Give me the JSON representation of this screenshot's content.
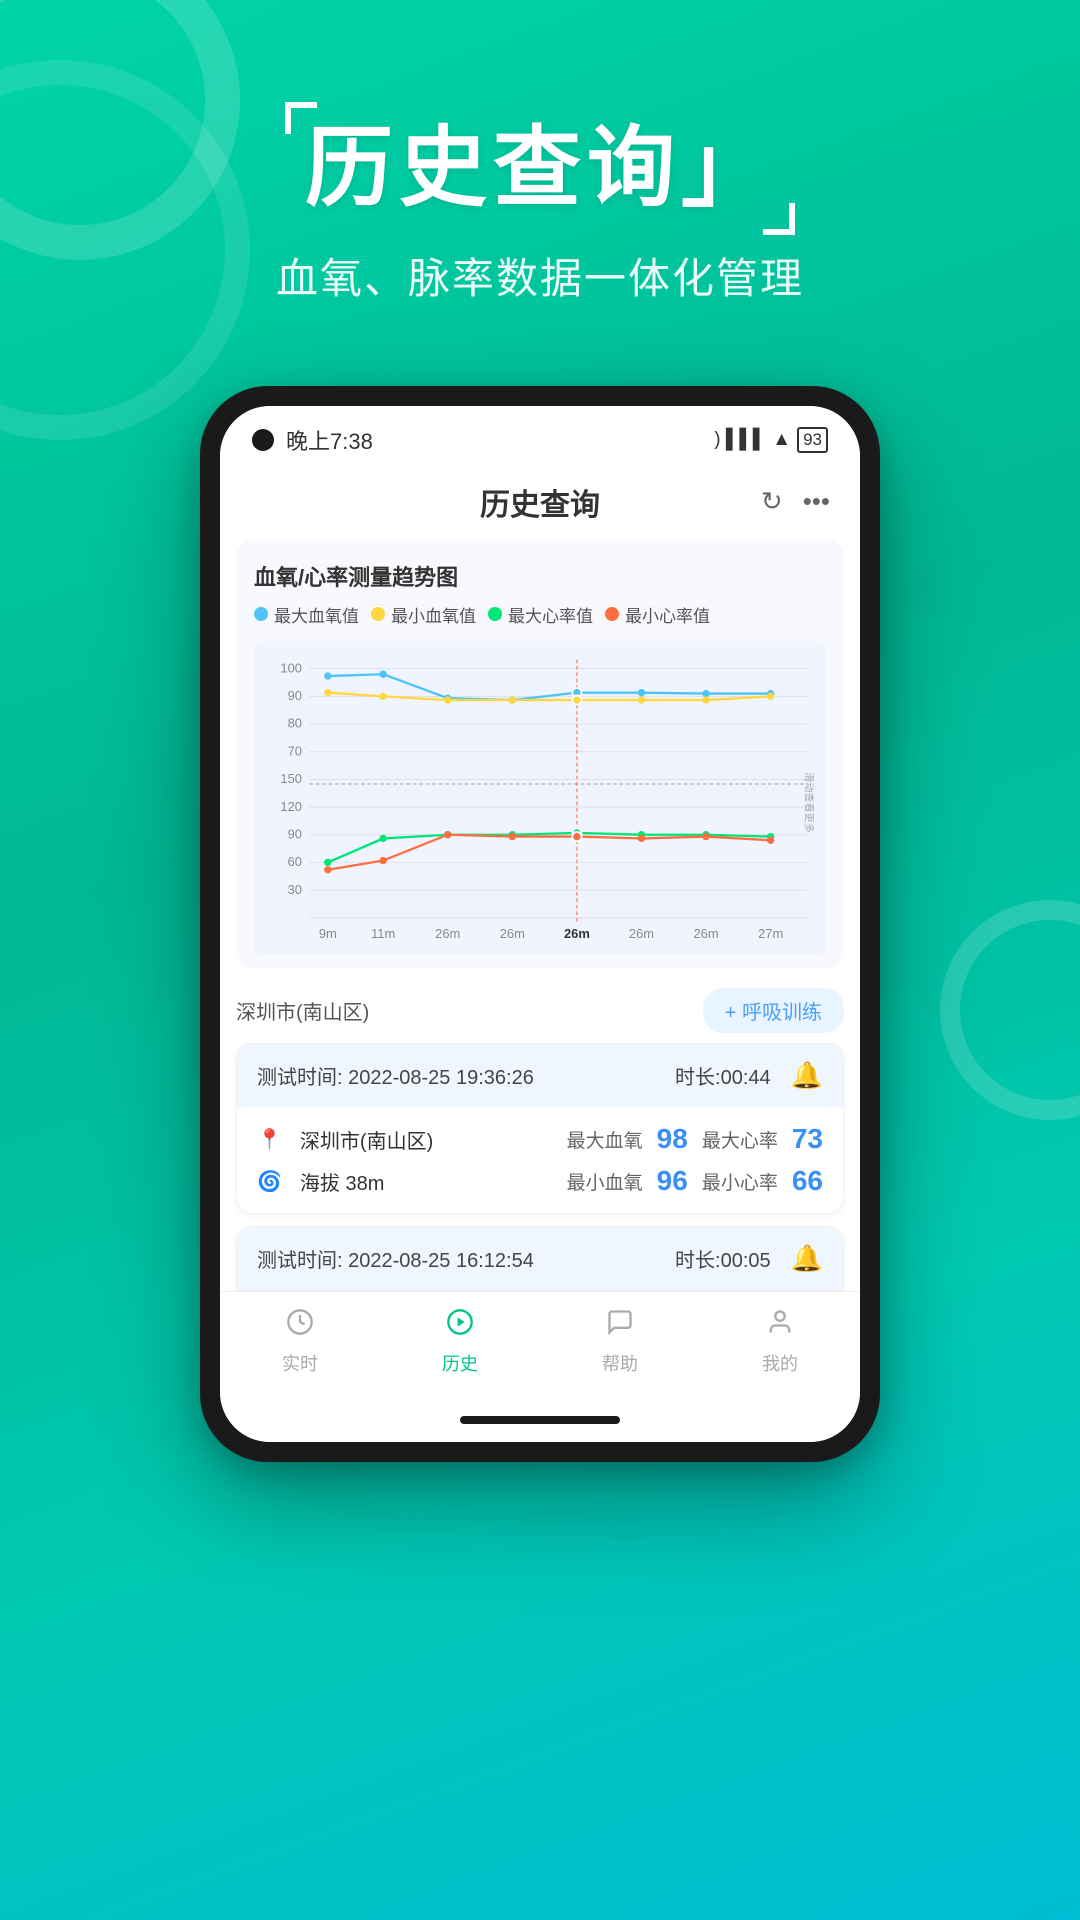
{
  "app": {
    "background_gradient_start": "#00d4a8",
    "background_gradient_end": "#00bcd4"
  },
  "header": {
    "title": "历史查询」",
    "title_prefix": "「历史查询",
    "subtitle": "血氧、脉率数据一体化管理"
  },
  "phone": {
    "status_bar": {
      "time": "晚上7:38",
      "battery": "93"
    },
    "app_title": "历史查询",
    "refresh_icon": "↻",
    "more_icon": "···"
  },
  "chart": {
    "title": "血氧/心率测量趋势图",
    "legend": [
      {
        "label": "最大血氧值",
        "color": "#4fc3f7"
      },
      {
        "label": "最小血氧值",
        "color": "#ffd740"
      },
      {
        "label": "最大心率值",
        "color": "#00e676"
      },
      {
        "label": "最小心率值",
        "color": "#ff6e40"
      }
    ],
    "y_labels_top": [
      "100",
      "90",
      "80",
      "70",
      "150"
    ],
    "y_labels_bottom": [
      "120",
      "90",
      "60",
      "30"
    ],
    "x_labels": [
      "9m",
      "11m",
      "26m",
      "26m",
      "26m",
      "26m",
      "26m",
      "27m"
    ],
    "selected_x": "26m",
    "scroll_hint": "滑动查看更多"
  },
  "location": {
    "city": "深圳市(南山区)",
    "breathing_btn": "+ 呼吸训练"
  },
  "records": [
    {
      "test_time_label": "测试时间:",
      "test_time": "2022-08-25 19:36:26",
      "duration_label": "时长:",
      "duration": "00:44",
      "location": "深圳市(南山区)",
      "max_blood_oxygen_label": "最大血氧",
      "max_blood_oxygen": "98",
      "max_heart_rate_label": "最大心率",
      "max_heart_rate": "73",
      "altitude_label": "海拔",
      "altitude": "38m",
      "min_blood_oxygen_label": "最小血氧",
      "min_blood_oxygen": "96",
      "min_heart_rate_label": "最小心率",
      "min_heart_rate": "66"
    },
    {
      "test_time_label": "测试时间:",
      "test_time": "2022-08-25 16:12:54",
      "duration_label": "时长:",
      "duration": "00:05"
    }
  ],
  "bottom_nav": {
    "items": [
      {
        "label": "实时",
        "icon": "clock",
        "active": false
      },
      {
        "label": "历史",
        "icon": "play",
        "active": true
      },
      {
        "label": "帮助",
        "icon": "chat",
        "active": false
      },
      {
        "label": "我的",
        "icon": "person",
        "active": false
      }
    ]
  }
}
